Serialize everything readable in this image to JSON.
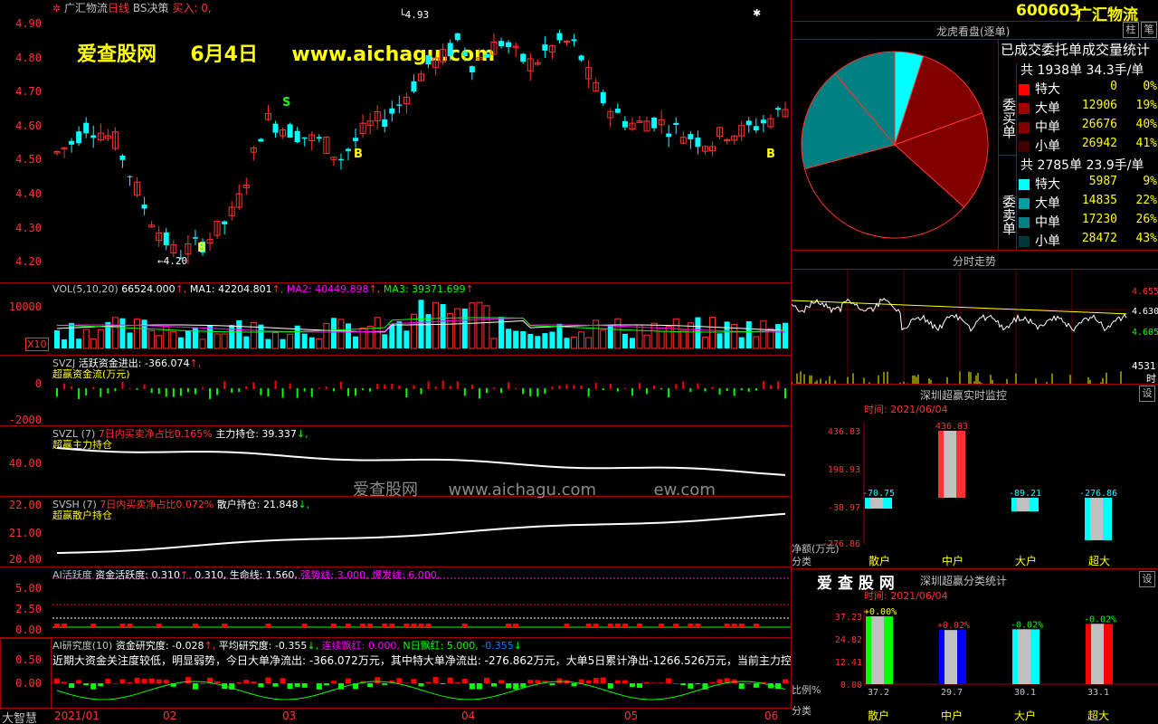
{
  "chart_header": {
    "settings_icon": "settings-icon",
    "stock": "广汇物流",
    "period": "日线",
    "strategy": "BS决策",
    "buy_text": "买入: 0,"
  },
  "watermark": {
    "site": "爱查股网",
    "date": "6月4日",
    "url": "www.aichagu.com",
    "mid_site": "爱查股网",
    "mid_url": "www.aichagu.com",
    "mid_tail": "ew.com"
  },
  "price_axis": [
    "4.90",
    "4.80",
    "4.70",
    "4.60",
    "4.50",
    "4.40",
    "4.30",
    "4.20"
  ],
  "price_markers": {
    "high": "4.93",
    "low": "4.20",
    "sell": "S",
    "buy": "B"
  },
  "vol_panel": {
    "label": "VOL(5,10,20)",
    "vol": "66524.000",
    "ma1_label": "MA1:",
    "ma1": "42204.801",
    "ma2_label": "MA2:",
    "ma2": "40449.898",
    "ma3_label": "MA3:",
    "ma3": "39371.699",
    "axis_top": "10000",
    "axis_unit": "X10"
  },
  "svzj_panel": {
    "label": "SVZJ",
    "text": "活跃资金进出: -366.074",
    "sub": "超赢资金流(万元)",
    "axis": [
      "0",
      "-2000"
    ]
  },
  "svzl_panel": {
    "label": "SVZL (7)",
    "ratio_label": "7日内买卖净占比",
    "ratio": "0.165%",
    "hold_label": "主力持仓:",
    "hold": "39.337",
    "sub": "超赢主力持仓",
    "axis": [
      "40.00"
    ]
  },
  "svsh_panel": {
    "label": "SVSH (7)",
    "ratio_label": "7日内买卖净占比",
    "ratio": "0.072%",
    "hold_label": "散户持仓:",
    "hold": "21.848",
    "sub": "超赢散户持仓",
    "axis": [
      "22.00",
      "21.00",
      "20.00"
    ]
  },
  "ai_active": {
    "label": "AI活跃度",
    "text1": "资金活跃度: 0.310",
    "text2": "0.310,",
    "text3": "生命线: 1.560,",
    "strong": "强势线: 3.000,",
    "burst": "爆发线: 6.000,",
    "axis": [
      "5.00",
      "2.50",
      "0.00"
    ]
  },
  "ai_research": {
    "label": "AI研究度(10)",
    "text1": "资金研究度: -0.028",
    "text2": "平均研究度: -0.355",
    "lian": "连续飘红: 0.000,",
    "n_red": "N日飘红: 5.000,",
    "tail": "-0.355",
    "comment": "近期大资金关注度较低，明显弱势，今日大单净流出: -366.072万元，其中特大单净流出: -276.862万元，大单5日累计净出-1266.526万元，当前主力控盘较",
    "axis": [
      "0.50",
      "0.00"
    ],
    "logo": "大智慧"
  },
  "date_axis": [
    "2021/01",
    "02",
    "03",
    "04",
    "05",
    "06"
  ],
  "right": {
    "code": "600603",
    "name": "广汇物流",
    "btn1": "柱",
    "btn2": "笔",
    "dragon_title": "龙虎看盘(逐单)",
    "stats_title": "已成交委托单成交量统计",
    "buy_side_label": "委买单",
    "sell_side_label": "委卖单",
    "buy_summary": "共 1938单 34.3手/单",
    "sell_summary": "共 2785单 23.9手/单",
    "buy_rows": [
      {
        "name": "特大",
        "value": "0",
        "pct": "0%",
        "color": "#ff0000"
      },
      {
        "name": "大单",
        "value": "12906",
        "pct": "19%",
        "color": "#a00000"
      },
      {
        "name": "中单",
        "value": "26676",
        "pct": "40%",
        "color": "#800000"
      },
      {
        "name": "小单",
        "value": "26942",
        "pct": "41%",
        "color": "#400000"
      }
    ],
    "sell_rows": [
      {
        "name": "特大",
        "value": "5987",
        "pct": "9%",
        "color": "#00ffff"
      },
      {
        "name": "大单",
        "value": "14835",
        "pct": "22%",
        "color": "#00a0a0"
      },
      {
        "name": "中单",
        "value": "17230",
        "pct": "26%",
        "color": "#008080"
      },
      {
        "name": "小单",
        "value": "28472",
        "pct": "43%",
        "color": "#003838"
      }
    ],
    "pie_pct": [
      {
        "label": "卖特大",
        "value": 9,
        "color": "#00ffff"
      },
      {
        "label": "买大单",
        "value": 19,
        "color": "#800000"
      },
      {
        "label": "买中单",
        "value": 40,
        "color": "#800000"
      },
      {
        "label": "买小单",
        "value": 41,
        "color": "#000000"
      }
    ],
    "intraday_title": "分时走势",
    "intraday_axis": [
      "4.655",
      "4.630",
      "4.605"
    ],
    "intraday_vol": "4531",
    "intraday_vol_unit": "时",
    "monitor_title": "深圳超赢实时监控",
    "monitor_time": "时间: 2021/06/04",
    "monitor_btn": "设",
    "monitor_axis": [
      "436.83",
      "198.93",
      "-38.97",
      "-276.86"
    ],
    "monitor_bars": [
      {
        "cat": "散户",
        "value": -70.75,
        "label": "-70.75",
        "color": "#00ffff"
      },
      {
        "cat": "中户",
        "value": 436.83,
        "label": "436.83",
        "color": "#ff3232"
      },
      {
        "cat": "大户",
        "value": -89.21,
        "label": "-89.21",
        "color": "#00ffff"
      },
      {
        "cat": "超大",
        "value": -276.86,
        "label": "-276.86",
        "color": "#00ffff"
      }
    ],
    "monitor_unit": "净额(万元)",
    "monitor_cat_label": "分类",
    "stat_brand": "爱 查 股 网",
    "stat_title": "深圳超赢分类统计",
    "stat_btn": "设",
    "stat_time": "时间: 2021/06/04",
    "stat_axis": [
      "37.23",
      "24.82",
      "12.41",
      "0.00"
    ],
    "stat_bars": [
      {
        "cat": "散户",
        "value": 37.2,
        "label": "37.2",
        "change": "+0.00%",
        "color": "#00ff00",
        "change_color": "#ffff00"
      },
      {
        "cat": "中户",
        "value": 29.7,
        "label": "29.7",
        "change": "+0.02%",
        "color": "#0000ff",
        "change_color": "#ff3232"
      },
      {
        "cat": "大户",
        "value": 30.1,
        "label": "30.1",
        "change": "-0.02%",
        "color": "#00ffff",
        "change_color": "#00ff00"
      },
      {
        "cat": "超大",
        "value": 33.1,
        "label": "33.1",
        "change": "-0.02%",
        "color": "#ff0000",
        "change_color": "#00ff00"
      }
    ],
    "stat_ratio_label": "比例%",
    "stat_cat_label": "分类"
  },
  "colors": {
    "up": "#ff3232",
    "down": "#00ffff",
    "border": "#a00000"
  }
}
